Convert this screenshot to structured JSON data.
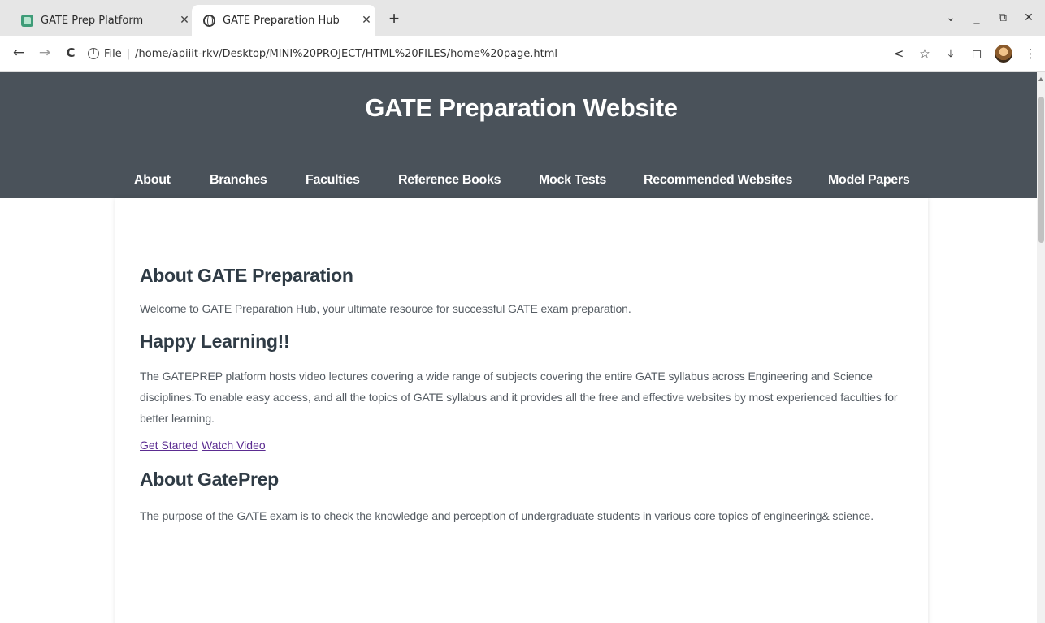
{
  "browser": {
    "tabs": [
      {
        "title": "GATE Prep Platform",
        "active": false,
        "favicon": "document-icon"
      },
      {
        "title": "GATE Preparation Hub",
        "active": true,
        "favicon": "globe-icon"
      }
    ],
    "new_tab_symbol": "+",
    "window_controls": {
      "dropdown": "⌄",
      "minimize": "_",
      "restore": "⧉",
      "close": "✕"
    },
    "nav": {
      "back": "←",
      "forward": "→",
      "reload": "C"
    },
    "address": {
      "scheme": "File",
      "path": "/home/apiiit-rkv/Desktop/MINI%20PROJECT/HTML%20FILES/home%20page.html"
    },
    "toolbar_icons": [
      "share-icon",
      "star-icon",
      "download-icon",
      "sidepanel-icon",
      "profile-avatar",
      "menu-icon"
    ],
    "toolbar_glyphs": {
      "share": "<",
      "star": "☆",
      "download": "⤓",
      "sidepanel": "◻",
      "menu": "⋮"
    }
  },
  "site": {
    "title": "GATE Preparation Website",
    "nav": [
      "About",
      "Branches",
      "Faculties",
      "Reference Books",
      "Mock Tests",
      "Recommended Websites",
      "Model Papers"
    ],
    "header_color": "#4a525a",
    "link_color": "#5b2c91"
  },
  "content": {
    "about_heading": "About GATE Preparation",
    "welcome_text": "Welcome to GATE Preparation Hub, your ultimate resource for successful GATE exam preparation.",
    "happy_heading": "Happy Learning!!",
    "platform_text": "The GATEPREP platform hosts video lectures covering a wide range of subjects covering the entire GATE syllabus across Engineering and Science disciplines.To enable easy access, and all the topics of GATE syllabus and it provides all the free and effective websites by most experienced faculties for better learning.",
    "get_started": "Get Started",
    "watch_video": "Watch Video",
    "gateprep_heading": "About GatePrep",
    "purpose_text": "The purpose of the GATE exam is to check the knowledge and perception of undergraduate students in various core topics of engineering& science."
  }
}
